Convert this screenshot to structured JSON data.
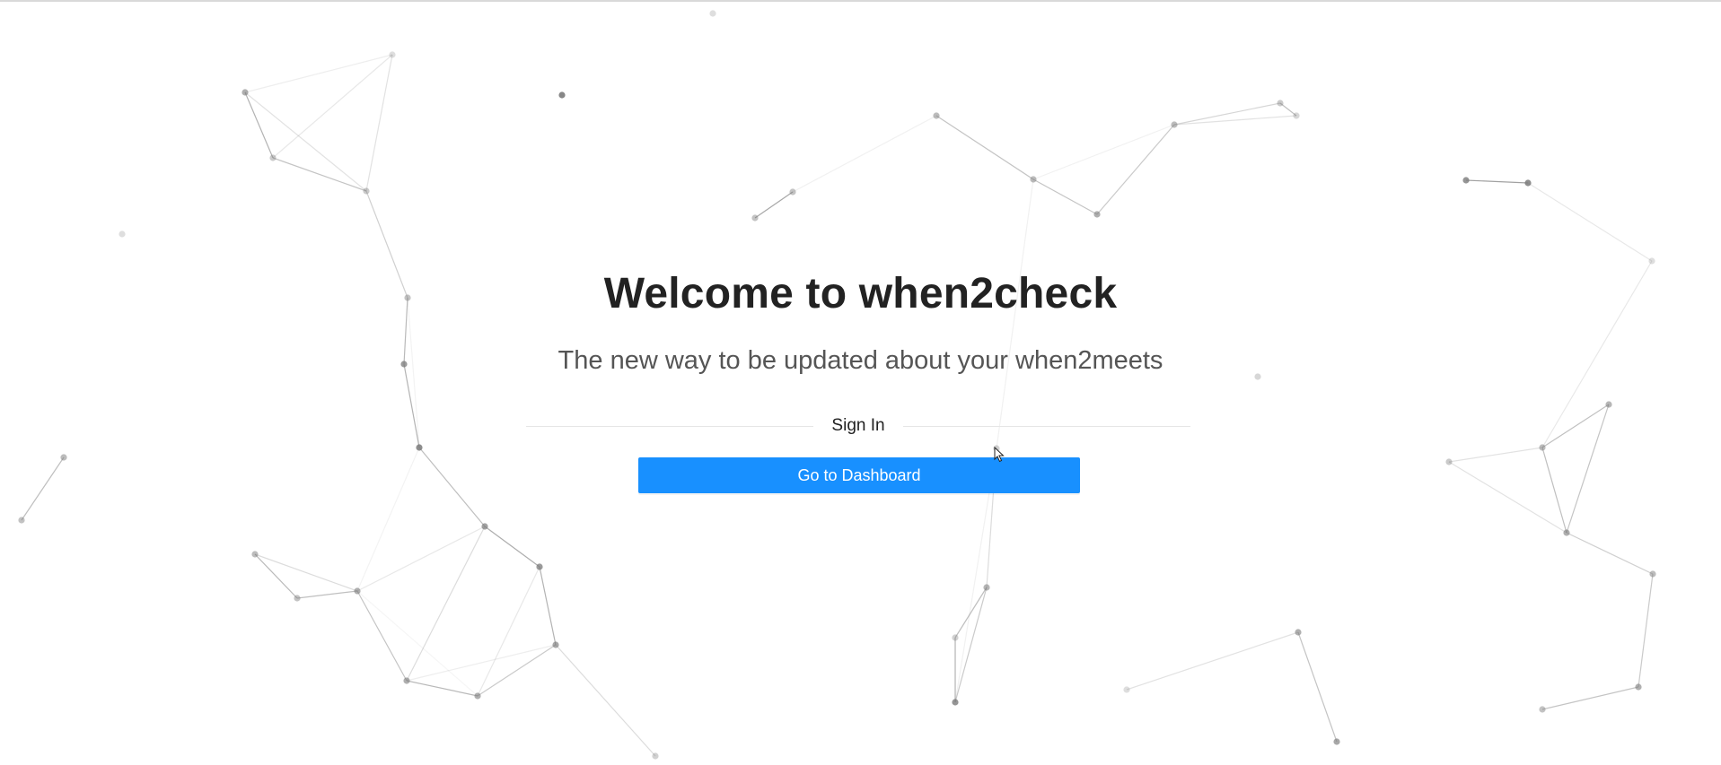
{
  "hero": {
    "title": "Welcome to when2check",
    "subtitle": "The new way to be updated about your when2meets"
  },
  "auth": {
    "divider_label": "Sign In",
    "dashboard_button_label": "Go to Dashboard"
  },
  "colors": {
    "primary": "#1890ff",
    "title_text": "#222222",
    "subtitle_text": "#555555",
    "network_node": "#7a7a7a",
    "network_line": "#8a8a8a"
  }
}
